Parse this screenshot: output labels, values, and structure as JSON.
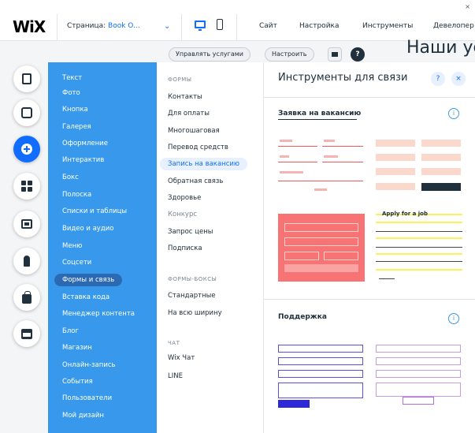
{
  "topbar": {
    "logo": "WiX",
    "page_label": "Страница:",
    "page_name": "Book O...",
    "menu": [
      "Сайт",
      "Настройка",
      "Инструменты",
      "Девелопер"
    ],
    "close": "×"
  },
  "canvas": {
    "btn_manage": "Управлять услугами",
    "btn_settings": "Настроить",
    "help": "?",
    "heading": "Наши ус"
  },
  "categories": [
    "Текст",
    "Фото",
    "Кнопка",
    "Галерея",
    "Оформление",
    "Интерактив",
    "Бокс",
    "Полоска",
    "Списки и таблицы",
    "Видео и аудио",
    "Меню",
    "Соцсети",
    "Формы и связь",
    "Вставка кода",
    "Менеджер контента",
    "Блог",
    "Магазин",
    "Онлайн-запись",
    "События",
    "Пользователи",
    "Мой дизайн"
  ],
  "categories_selected": "Формы и связь",
  "subcategories": {
    "head_forms": "ФОРМЫ",
    "forms": [
      "Контакты",
      "Для оплаты",
      "Многошаговая",
      "Перевод средств",
      "Запись на вакансию",
      "Обратная связь",
      "Здоровье",
      "Конкурс",
      "Запрос цены",
      "Подписка"
    ],
    "selected": "Запись на вакансию",
    "dim": [
      "Конкурс"
    ],
    "head_boxes": "ФОРМЫ-БОКСЫ",
    "boxes": [
      "Стандартные",
      "На всю ширину"
    ],
    "head_chat": "ЧАТ",
    "chat": [
      "Wix Чат",
      "LINE"
    ]
  },
  "content": {
    "title": "Инструменты для связи",
    "help": "?",
    "close": "×",
    "section1": "Заявка на вакансию",
    "section2": "Поддержка",
    "info": "i",
    "thumb_apply": "Apply for a job"
  },
  "colors": {
    "accent": "#116dff",
    "panel_blue": "#3899ec",
    "selected_pill": "#2b6ab3",
    "coral": "#f87474",
    "yellow": "#fdf05a",
    "support_blue": "#2f28d8"
  }
}
